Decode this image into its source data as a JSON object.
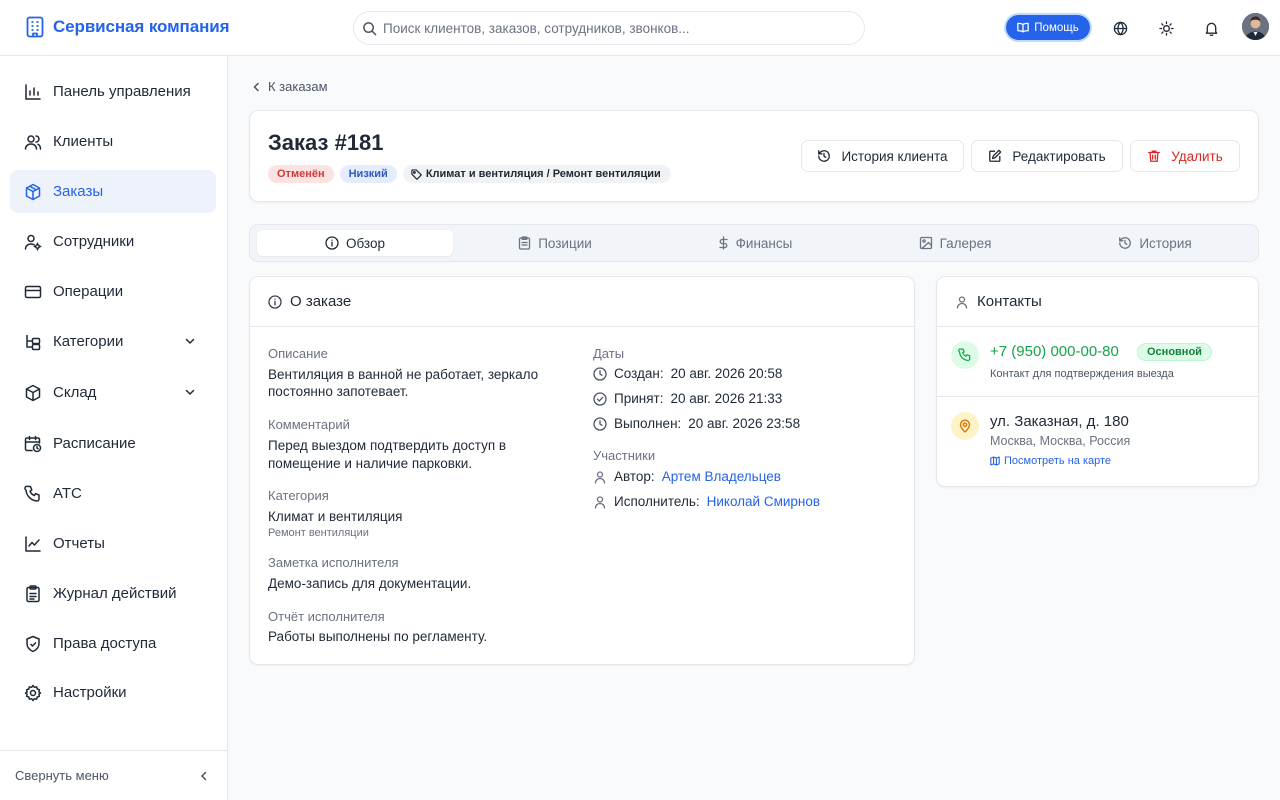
{
  "topbar": {
    "brand": "Сервисная компания",
    "search_placeholder": "Поиск клиентов, заказов, сотрудников, звонков...",
    "help_label": "Помощь"
  },
  "sidebar": {
    "items": [
      {
        "label": "Панель управления"
      },
      {
        "label": "Клиенты"
      },
      {
        "label": "Заказы"
      },
      {
        "label": "Сотрудники"
      },
      {
        "label": "Операции"
      },
      {
        "label": "Категории"
      },
      {
        "label": "Склад"
      },
      {
        "label": "Расписание"
      },
      {
        "label": "АТС"
      },
      {
        "label": "Отчеты"
      },
      {
        "label": "Журнал действий"
      },
      {
        "label": "Права доступа"
      },
      {
        "label": "Настройки"
      }
    ],
    "collapse_label": "Свернуть меню"
  },
  "page": {
    "back_label": "К заказам",
    "title": "Заказ #181",
    "badges": {
      "status": "Отменён",
      "priority": "Низкий",
      "category": "Климат и вентиляция / Ремонт вентиляции"
    },
    "actions": {
      "history": "История клиента",
      "edit": "Редактировать",
      "delete": "Удалить"
    }
  },
  "tabs": [
    {
      "label": "Обзор"
    },
    {
      "label": "Позиции"
    },
    {
      "label": "Финансы"
    },
    {
      "label": "Галерея"
    },
    {
      "label": "История"
    }
  ],
  "about": {
    "title": "О заказе",
    "description_label": "Описание",
    "description_line1": "Вентиляция в ванной не работает, зеркало",
    "description_line2": "постоянно запотевает.",
    "comment_label": "Комментарий",
    "comment_line1": "Перед выездом подтвердить доступ в",
    "comment_line2": "помещение и наличие парковки.",
    "category_label": "Категория",
    "category_value": "Климат и вентиляция",
    "subcategory_value": "Ремонт вентиляции",
    "note_label": "Заметка исполнителя",
    "note_value": "Демо-запись для документации.",
    "report_label": "Отчёт исполнителя",
    "report_value": "Работы выполнены по регламенту.",
    "dates_label": "Даты",
    "created_label": "Создан:",
    "created_value": "20 авг. 2026 20:58",
    "accepted_label": "Принят:",
    "accepted_value": "20 авг. 2026 21:33",
    "completed_label": "Выполнен:",
    "completed_value": "20 авг. 2026 23:58",
    "participants_label": "Участники",
    "author_label": "Автор:",
    "author_value": "Артем Владельцев",
    "executor_label": "Исполнитель:",
    "executor_value": "Николай Смирнов"
  },
  "contacts": {
    "title": "Контакты",
    "phone": "+7 (950) 000-00-80",
    "phone_badge": "Основной",
    "phone_note": "Контакт для подтверждения выезда",
    "address": "ул. Заказная, д. 180",
    "city": "Москва, Москва, Россия",
    "map_link": "Посмотреть на карте"
  },
  "colors": {
    "accent": "#2563eb",
    "danger": "#dc2626",
    "success": "#16a34a"
  }
}
